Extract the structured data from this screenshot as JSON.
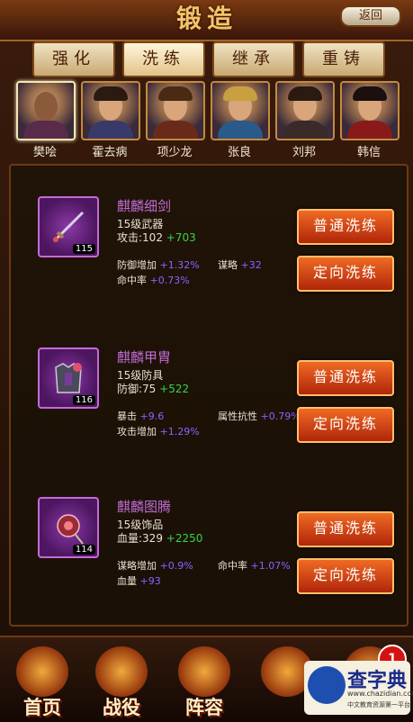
{
  "title": "锻造",
  "back_label": "返回",
  "tabs": [
    {
      "label": "强化"
    },
    {
      "label": "洗练"
    },
    {
      "label": "继承"
    },
    {
      "label": "重铸"
    }
  ],
  "heroes": [
    {
      "name": "樊哙"
    },
    {
      "name": "霍去病"
    },
    {
      "name": "项少龙"
    },
    {
      "name": "张良"
    },
    {
      "name": "刘邦"
    },
    {
      "name": "韩信"
    }
  ],
  "items": [
    {
      "name": "麒麟细剑",
      "level_badge": "115",
      "type": "15级武器",
      "base_label": "攻击:",
      "base_value": "102",
      "base_plus": "+703",
      "stats": [
        {
          "label": "防御增加",
          "value": "+1.32%"
        },
        {
          "label": "谋略",
          "value": "+32"
        },
        {
          "label": "命中率",
          "value": "+0.73%"
        }
      ],
      "btn_normal": "普通洗练",
      "btn_directed": "定向洗练"
    },
    {
      "name": "麒麟甲胄",
      "level_badge": "116",
      "type": "15级防具",
      "base_label": "防御:",
      "base_value": "75",
      "base_plus": "+522",
      "stats": [
        {
          "label": "暴击",
          "value": "+9.6"
        },
        {
          "label": "属性抗性",
          "value": "+0.79%"
        },
        {
          "label": "攻击增加",
          "value": "+1.29%"
        }
      ],
      "btn_normal": "普通洗练",
      "btn_directed": "定向洗练"
    },
    {
      "name": "麒麟图腾",
      "level_badge": "114",
      "type": "15级饰品",
      "base_label": "血量:",
      "base_value": "329",
      "base_plus": "+2250",
      "stats": [
        {
          "label": "谋略增加",
          "value": "+0.9%"
        },
        {
          "label": "命中率",
          "value": "+1.07%"
        },
        {
          "label": "血量",
          "value": "+93"
        }
      ],
      "btn_normal": "普通洗练",
      "btn_directed": "定向洗练"
    }
  ],
  "bottom_nav": [
    {
      "label": "首页"
    },
    {
      "label": "战役"
    },
    {
      "label": "阵容"
    },
    {
      "label": ""
    },
    {
      "label": ""
    }
  ],
  "notification_count": "1",
  "watermark": {
    "text": "查字典",
    "url": "www.chazidian.com",
    "sub": "中文教育资源第一平台"
  }
}
